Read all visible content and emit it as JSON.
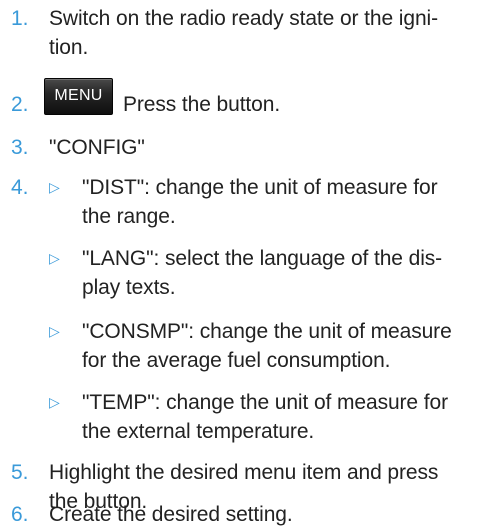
{
  "steps": [
    {
      "num": "1.",
      "lines": [
        "Switch on the radio ready state or the igni-",
        "tion."
      ]
    },
    {
      "num": "2.",
      "button": "MENU",
      "text": "Press the button."
    },
    {
      "num": "3.",
      "text": "\"CONFIG\""
    },
    {
      "num": "4.",
      "bullet": "▷",
      "subitems": [
        {
          "lines": [
            "\"DIST\": change the unit of measure for",
            "the range."
          ]
        },
        {
          "lines": [
            "\"LANG\": select the language of the dis-",
            "play texts."
          ]
        },
        {
          "lines": [
            "\"CONSMP\": change the unit of measure",
            "for the average fuel consumption."
          ]
        },
        {
          "lines": [
            "\"TEMP\": change the unit of measure for",
            "the external temperature."
          ]
        }
      ]
    },
    {
      "num": "5.",
      "lines": [
        "Highlight the desired menu item and press",
        "the button."
      ]
    },
    {
      "num": "6.",
      "text": "Create the desired setting."
    }
  ]
}
